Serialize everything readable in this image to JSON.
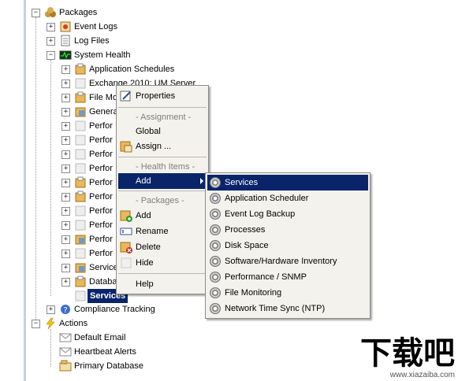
{
  "tree": {
    "packages": "Packages",
    "event_logs": "Event Logs",
    "log_files": "Log Files",
    "system_health": "System Health",
    "children": [
      "Application Schedules",
      "Exchange 2010: UM Server",
      "File Mo",
      "Genera",
      "Perfor",
      "Perfor",
      "Perfor",
      "Perfor",
      "Perfor",
      "Perfor",
      "Perfor",
      "Perfor",
      "Perfor",
      "Perfor",
      "Service",
      "Databa"
    ],
    "services_selected": "Services",
    "compliance_tracking": "Compliance Tracking",
    "actions": "Actions",
    "default_email": "Default Email",
    "heartbeat_alerts": "Heartbeat Alerts",
    "primary_database": "Primary Database"
  },
  "context_menu": {
    "properties": "Properties",
    "assignment_header": "- Assignment -",
    "global": "Global",
    "assign": "Assign ...",
    "health_items_header": "- Health Items -",
    "add": "Add",
    "packages_header": "- Packages -",
    "add_package": "Add",
    "rename": "Rename",
    "delete": "Delete",
    "hide": "Hide",
    "help": "Help"
  },
  "submenu": {
    "items": [
      "Services",
      "Application Scheduler",
      "Event Log Backup",
      "Processes",
      "Disk Space",
      "Software/Hardware Inventory",
      "Performance / SNMP",
      "File Monitoring",
      "Network Time Sync (NTP)"
    ]
  },
  "watermark": {
    "logo": "下载吧",
    "url": "www.xiazaiba.com"
  },
  "colors": {
    "selection": "#0a246a",
    "menu_bg": "#f4f2ec"
  }
}
